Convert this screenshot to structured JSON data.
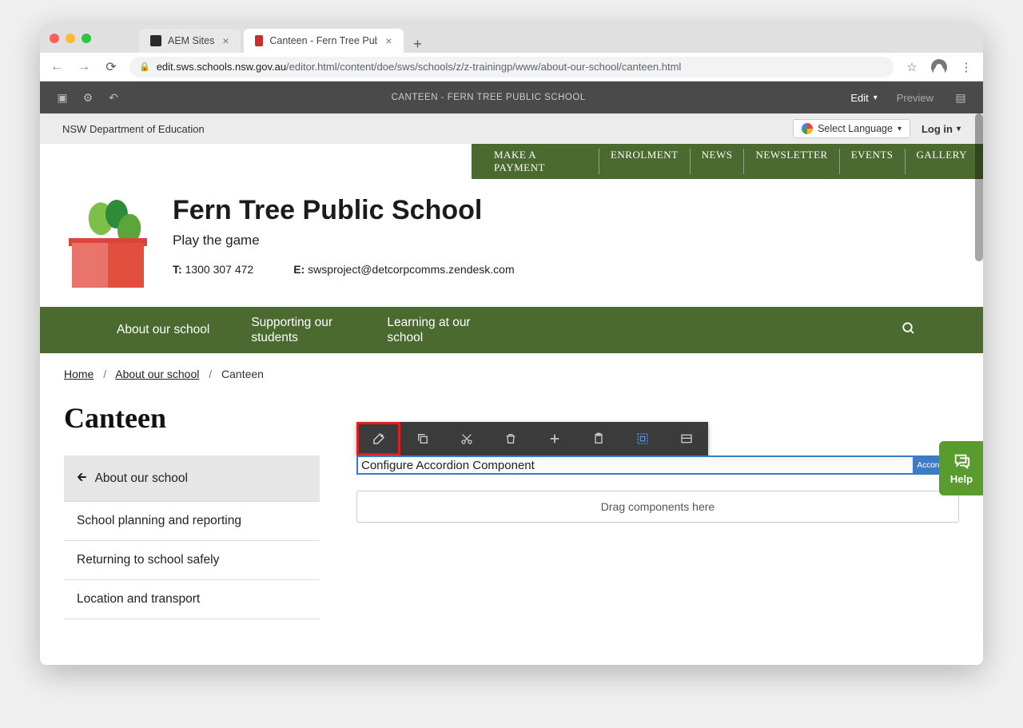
{
  "browser": {
    "tab1": "AEM Sites",
    "tab2": "Canteen - Fern Tree Public Sch",
    "domain": "edit.sws.schools.nsw.gov.au",
    "path": "/editor.html/content/doe/sws/schools/z/z-trainingp/www/about-our-school/canteen.html"
  },
  "aem": {
    "title": "CANTEEN - FERN TREE PUBLIC SCHOOL",
    "mode": "Edit",
    "preview": "Preview"
  },
  "topstrip": {
    "dept": "NSW Department of Education",
    "lang": "Select Language",
    "login": "Log in"
  },
  "greenlinks": [
    "MAKE A PAYMENT",
    "ENROLMENT",
    "NEWS",
    "NEWSLETTER",
    "EVENTS",
    "GALLERY"
  ],
  "school": {
    "name": "Fern Tree Public School",
    "tagline": "Play the game",
    "phone_label": "T:",
    "phone": "1300 307 472",
    "email_label": "E:",
    "email": "swsproject@detcorpcomms.zendesk.com"
  },
  "mainnav": [
    "About our school",
    "Supporting our students",
    "Learning at our school"
  ],
  "crumbs": {
    "home": "Home",
    "l2": "About our school",
    "current": "Canteen"
  },
  "page_title": "Canteen",
  "sidenav": {
    "back": "About our school",
    "items": [
      "School planning and reporting",
      "Returning to school safely",
      "Location and transport"
    ]
  },
  "component": {
    "label": "Configure Accordion Component",
    "badge": "Accordion",
    "dropzone": "Drag components here"
  },
  "help": "Help"
}
